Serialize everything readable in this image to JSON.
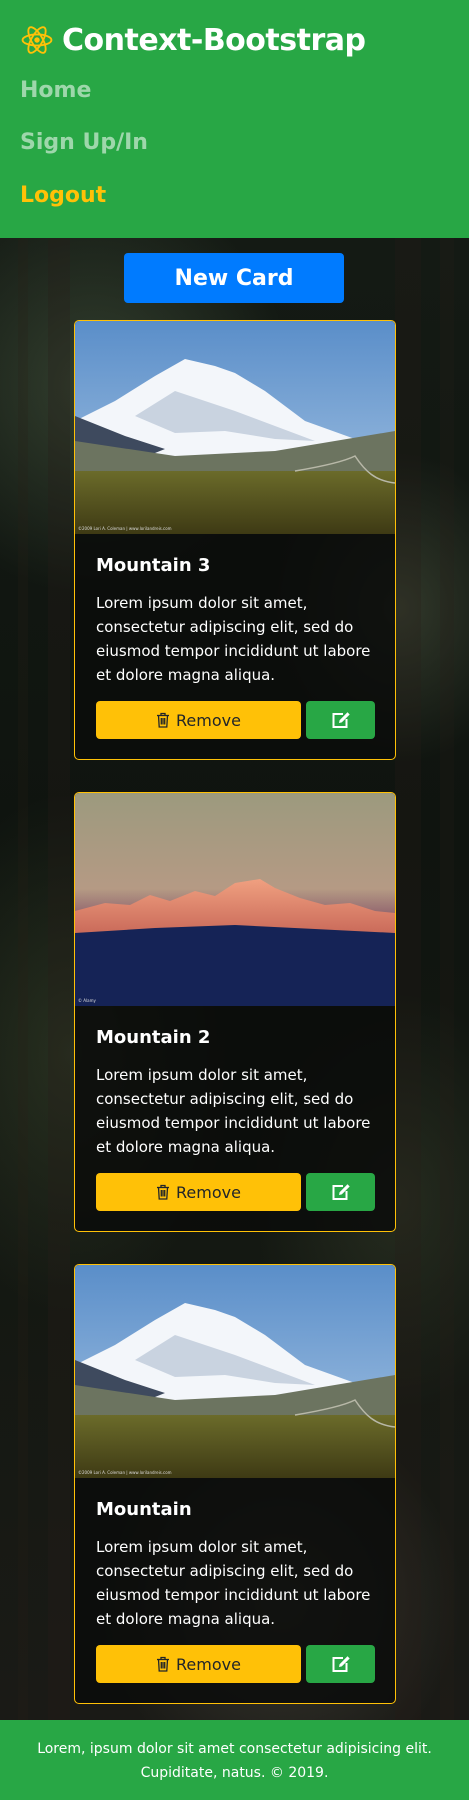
{
  "navbar": {
    "brand": "Context-Bootstrap",
    "brand_icon": "react-icon",
    "links": [
      {
        "label": "Home"
      },
      {
        "label": "Sign Up/In"
      },
      {
        "label": "Logout"
      }
    ],
    "colors": {
      "background": "#28a745",
      "active": "#ffc107"
    }
  },
  "new_card_button": "New Card",
  "cards": [
    {
      "title": "Mountain 3",
      "text": "Lorem ipsum dolor sit amet, consectetur adipiscing elit, sed do eiusmod tempor incididunt ut labore et dolore magna aliqua.",
      "image": "snowy-mountain-valley",
      "image_credit": "©2009 Lori A. Coleman | www.lorilandreis.com",
      "remove_label": "Remove",
      "edit_icon": "edit-icon"
    },
    {
      "title": "Mountain 2",
      "text": "Lorem ipsum dolor sit amet, consectetur adipiscing elit, sed do eiusmod tempor incididunt ut labore et dolore magna aliqua.",
      "image": "mountain-range-sunset",
      "image_credit": "© Alamy",
      "remove_label": "Remove",
      "edit_icon": "edit-icon"
    },
    {
      "title": "Mountain",
      "text": "Lorem ipsum dolor sit amet, consectetur adipiscing elit, sed do eiusmod tempor incididunt ut labore et dolore magna aliqua.",
      "image": "snowy-mountain-valley",
      "image_credit": "©2009 Lori A. Coleman | www.lorilandreis.com",
      "remove_label": "Remove",
      "edit_icon": "edit-icon"
    }
  ],
  "footer": {
    "line1": "Lorem, ipsum dolor sit amet consectetur adipisicing elit.",
    "line2": "Cupiditate, natus. © 2019."
  }
}
